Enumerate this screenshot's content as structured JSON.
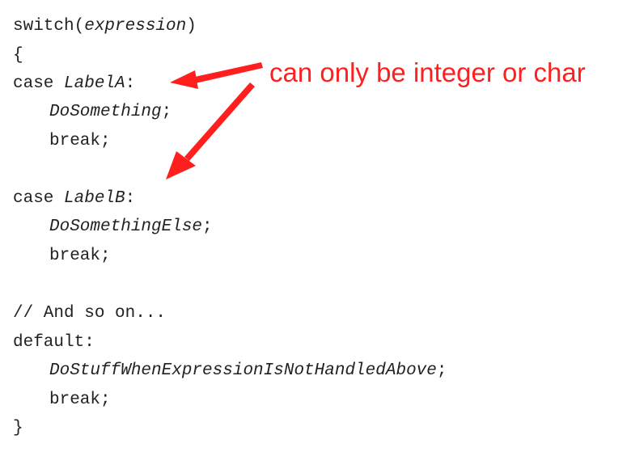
{
  "code": {
    "switch_kw": "switch(",
    "switch_expr": "expression",
    "switch_close": ")",
    "open_brace": "{",
    "case_a_kw": "case ",
    "case_a_label": "LabelA",
    "case_a_colon": ":",
    "case_a_body": "DoSomething",
    "case_a_semi": ";",
    "case_a_break": "break;",
    "case_b_kw": "case ",
    "case_b_label": "LabelB",
    "case_b_colon": ":",
    "case_b_body": "DoSomethingElse",
    "case_b_semi": ";",
    "case_b_break": "break;",
    "comment": "// And so on...",
    "default_kw": "default:",
    "default_body": "DoStuffWhenExpressionIsNotHandledAbove",
    "default_semi": ";",
    "default_break": "break;",
    "close_brace": "}"
  },
  "annotation": {
    "text": "can only be integer or char",
    "color": "#ff1f1f"
  }
}
